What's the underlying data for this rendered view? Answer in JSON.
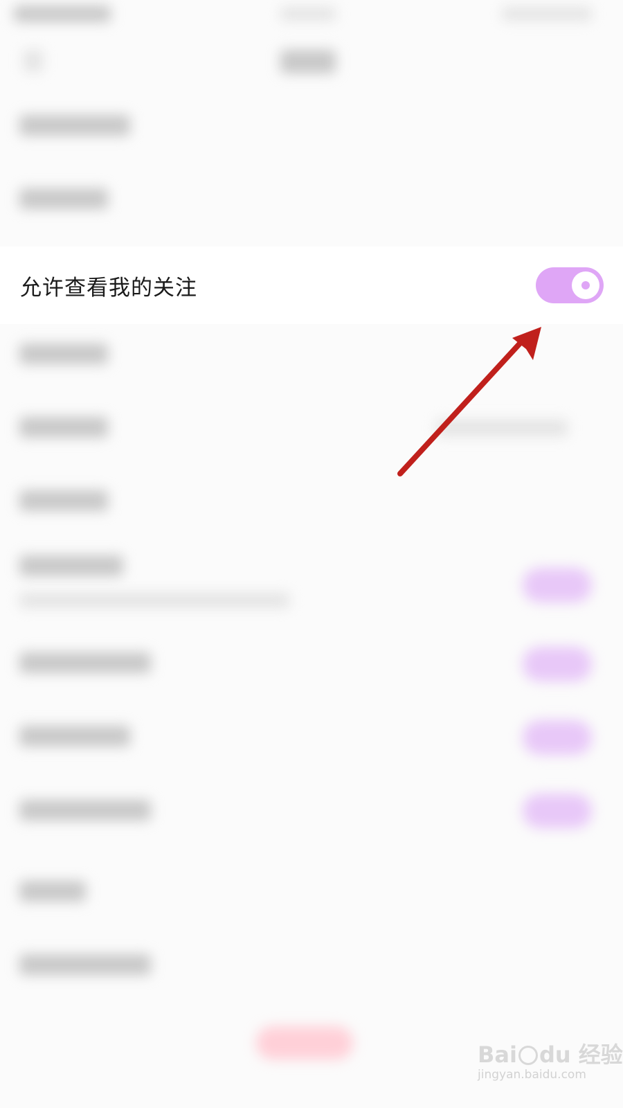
{
  "privacy_row": {
    "label": "允许查看我的关注",
    "toggle_on": true,
    "toggle_color": "#dfa6f6"
  },
  "annotation": {
    "arrow_color": "#c0201c"
  },
  "watermark": {
    "brand": "Bai",
    "brand_suffix": "du 经验",
    "url": "jingyan.baidu.com"
  }
}
